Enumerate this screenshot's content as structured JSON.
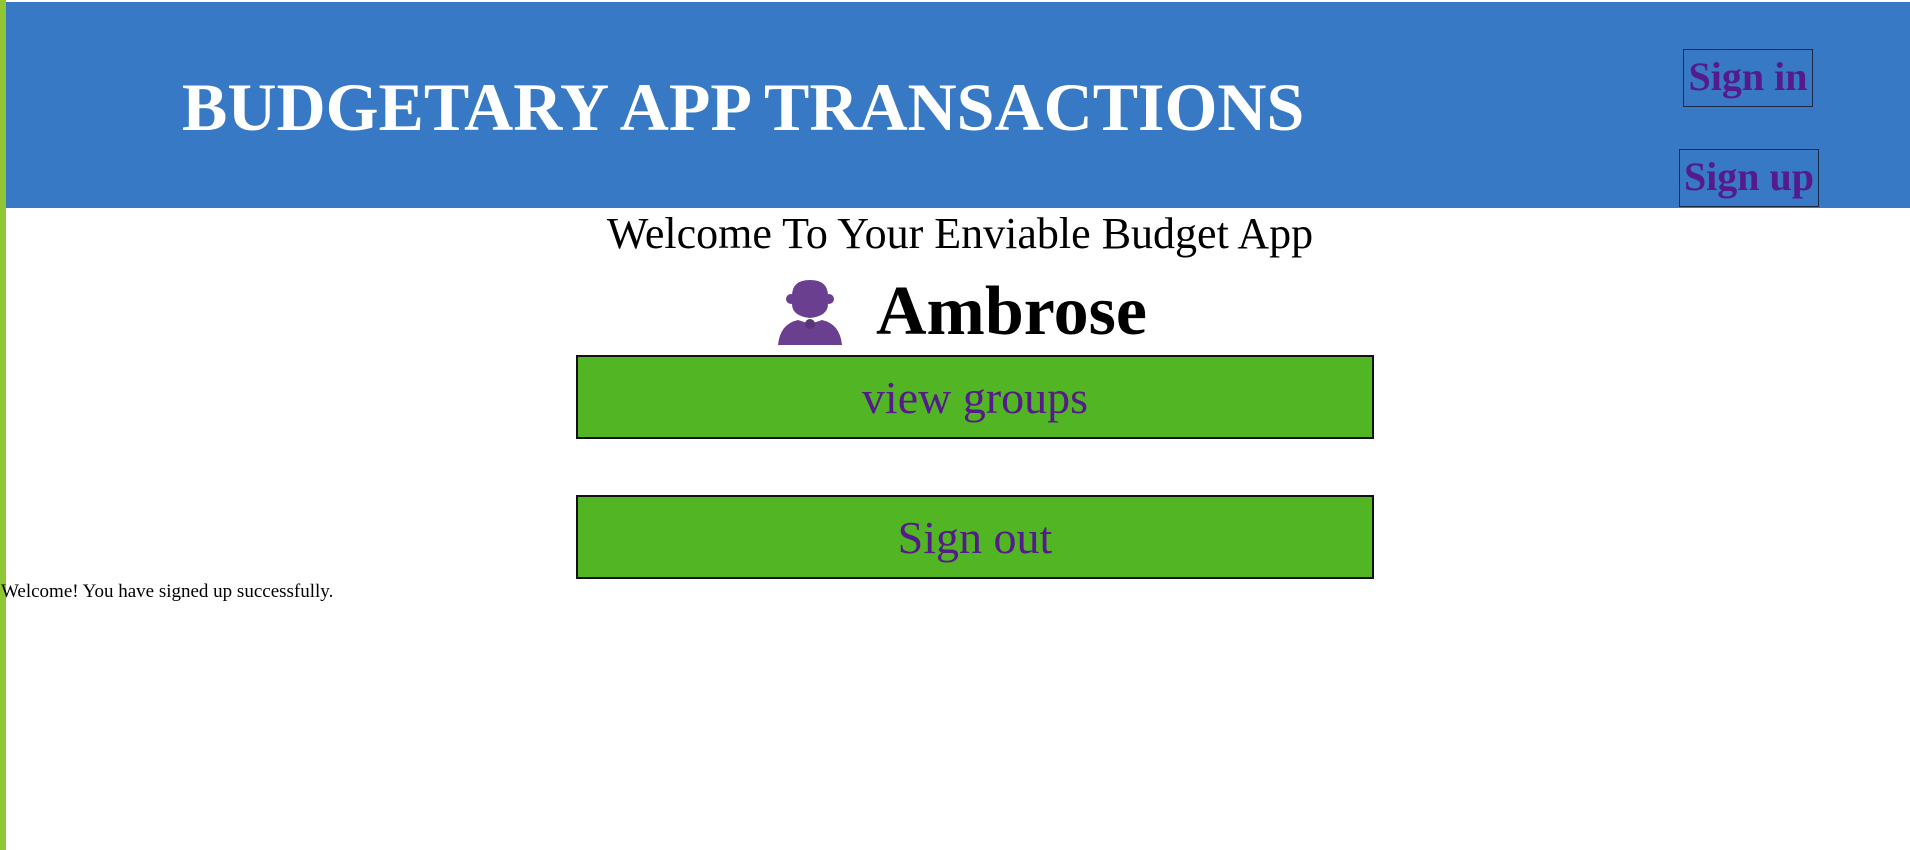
{
  "header": {
    "title": "BUDGETARY APP TRANSACTIONS",
    "background_color": "#3779c5",
    "sign_in_label": "Sign in",
    "sign_up_label": "Sign up"
  },
  "main": {
    "welcome_heading": "Welcome To Your Enviable Budget App",
    "user": {
      "avatar_icon": "user-silhouette-icon",
      "name": "Ambrose"
    },
    "buttons": {
      "view_groups_label": "view groups",
      "sign_out_label": "Sign out",
      "button_color": "#51b524"
    }
  },
  "flash": {
    "notice": "Welcome! You have signed up successfully."
  },
  "colors": {
    "link_purple": "#551a8b",
    "left_accent_bar": "#8fc633",
    "avatar_purple": "#6b3f8f"
  }
}
